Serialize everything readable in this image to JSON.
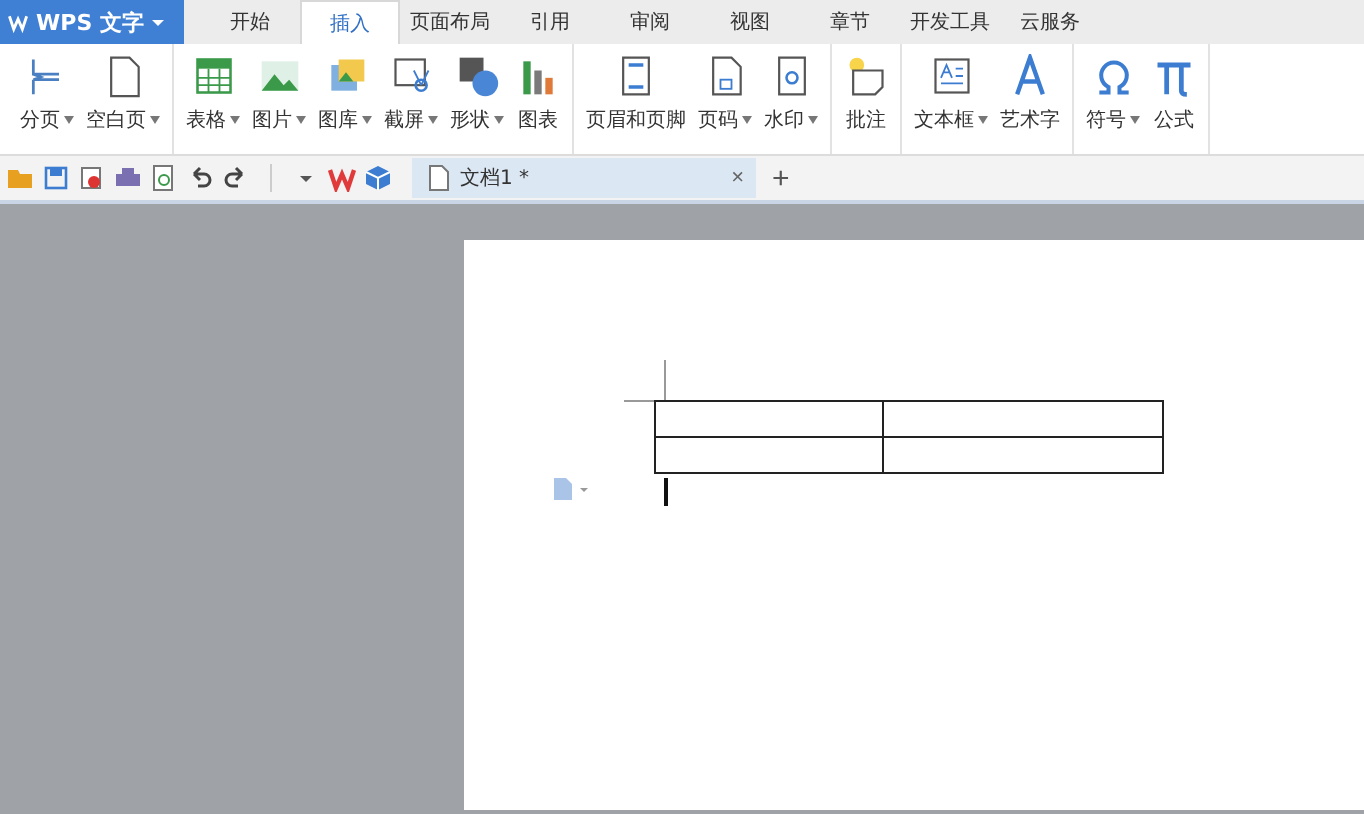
{
  "app_menu": {
    "label": "WPS 文字"
  },
  "tabs": [
    {
      "label": "开始",
      "selected": false
    },
    {
      "label": "插入",
      "selected": true
    },
    {
      "label": "页面布局",
      "selected": false
    },
    {
      "label": "引用",
      "selected": false
    },
    {
      "label": "审阅",
      "selected": false
    },
    {
      "label": "视图",
      "selected": false
    },
    {
      "label": "章节",
      "selected": false
    },
    {
      "label": "开发工具",
      "selected": false
    },
    {
      "label": "云服务",
      "selected": false
    }
  ],
  "ribbon": {
    "groups": [
      {
        "items": [
          {
            "label": "分页",
            "dropdown": true
          },
          {
            "label": "空白页",
            "dropdown": true
          }
        ]
      },
      {
        "items": [
          {
            "label": "表格",
            "dropdown": true
          },
          {
            "label": "图片",
            "dropdown": true
          },
          {
            "label": "图库",
            "dropdown": true
          },
          {
            "label": "截屏",
            "dropdown": true
          },
          {
            "label": "形状",
            "dropdown": true
          },
          {
            "label": "图表",
            "dropdown": false
          }
        ]
      },
      {
        "items": [
          {
            "label": "页眉和页脚",
            "dropdown": false
          },
          {
            "label": "页码",
            "dropdown": true
          },
          {
            "label": "水印",
            "dropdown": true
          }
        ]
      },
      {
        "items": [
          {
            "label": "批注",
            "dropdown": false
          }
        ]
      },
      {
        "items": [
          {
            "label": "文本框",
            "dropdown": true
          },
          {
            "label": "艺术字",
            "dropdown": false
          }
        ]
      },
      {
        "items": [
          {
            "label": "符号",
            "dropdown": true
          },
          {
            "label": "公式",
            "dropdown": false
          }
        ]
      }
    ]
  },
  "document_tab": {
    "title": "文档1 *",
    "close": "×",
    "selected": true
  },
  "new_tab": "+"
}
